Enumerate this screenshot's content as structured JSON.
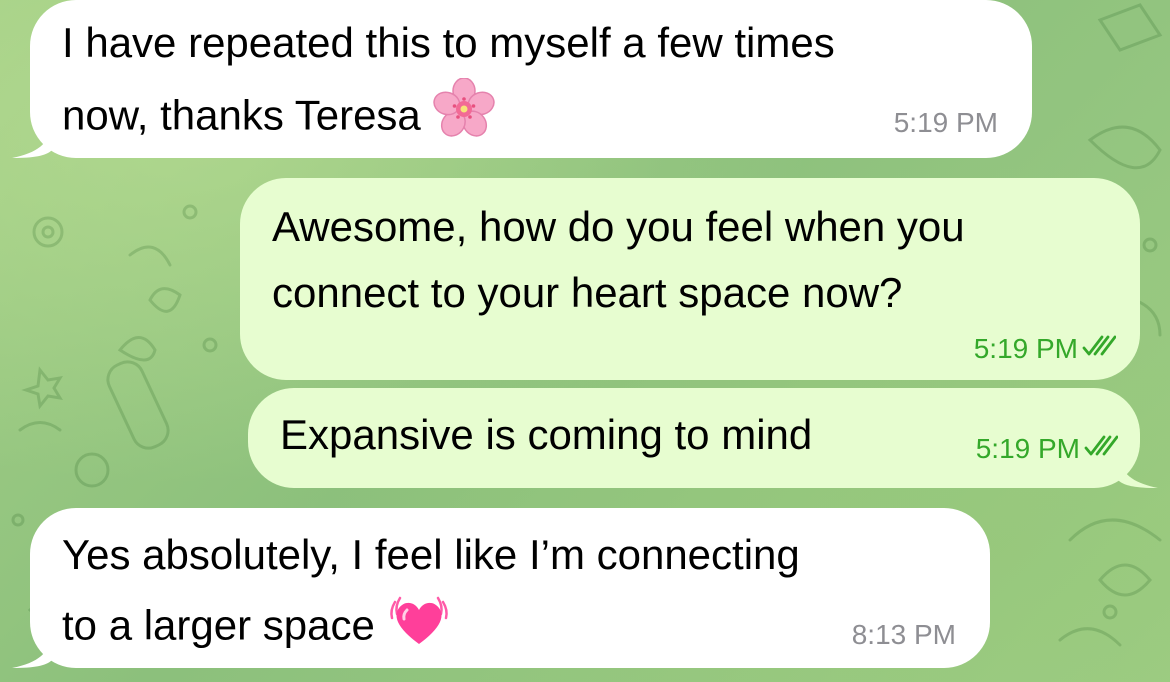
{
  "chat": {
    "messages": [
      {
        "direction": "incoming",
        "lines": [
          "I have repeated this to myself a few times",
          "now, thanks Teresa"
        ],
        "emoji": "cherry-blossom-icon",
        "time": "5:19 PM"
      },
      {
        "direction": "outgoing",
        "lines": [
          "Awesome, how do you feel when you",
          "connect to your heart space now?"
        ],
        "time": "5:19 PM",
        "status": "read"
      },
      {
        "direction": "outgoing",
        "lines": [
          "Expansive is coming to mind"
        ],
        "time": "5:19 PM",
        "status": "read"
      },
      {
        "direction": "incoming",
        "lines": [
          "Yes absolutely, I feel like I’m connecting",
          "to a larger space"
        ],
        "emoji": "growing-heart-icon",
        "time": "8:13 PM"
      }
    ]
  },
  "colors": {
    "incoming_bubble": "#ffffff",
    "outgoing_bubble": "#e7fdd0",
    "outgoing_time": "#34a82a",
    "incoming_time": "#8e8e93",
    "wallpaper": "#8fc27f"
  }
}
